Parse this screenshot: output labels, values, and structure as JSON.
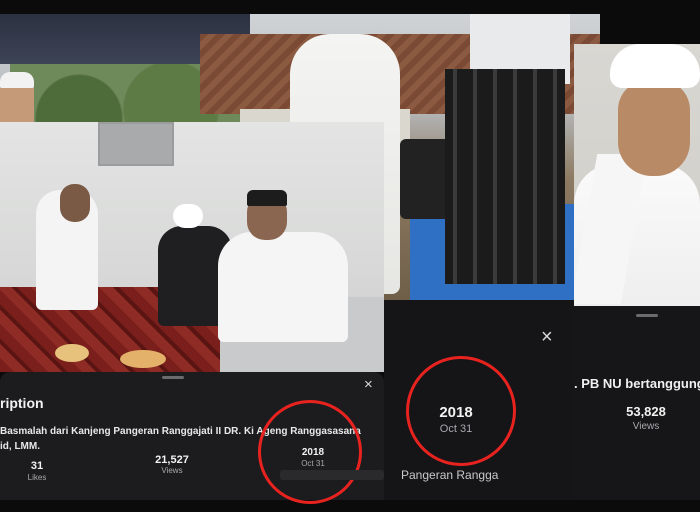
{
  "left_panel": {
    "section_title": "ription",
    "description_line1": "Basmalah dari Kanjeng Pangeran Ranggajati II DR. Ki Ageng Ranggasasana",
    "description_line2": "id, LMM.",
    "likes": {
      "value": "31",
      "label": "Likes"
    },
    "views": {
      "value": "21,527",
      "label": "Views"
    },
    "date": {
      "year": "2018",
      "day": "Oct 31"
    },
    "close_glyph": "×"
  },
  "middle_panel": {
    "date": {
      "year": "2018",
      "day": "Oct 31"
    },
    "channel_name": "Pangeran Rangga",
    "close_glyph": "×"
  },
  "right_panel": {
    "title": ". PB NU bertanggung",
    "views": {
      "value": "53,828",
      "label": "Views"
    }
  },
  "colors": {
    "highlight_ring": "#e8231f",
    "sheet_bg": "#1c1c1e"
  },
  "icons": [
    "close-icon",
    "drag-handle"
  ]
}
